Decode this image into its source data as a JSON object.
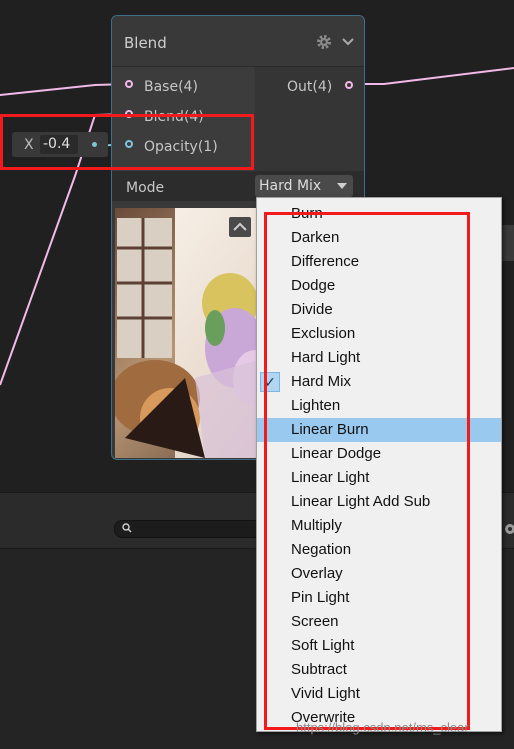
{
  "node": {
    "title": "Blend",
    "inputs": [
      {
        "label": "Base(4)"
      },
      {
        "label": "Blend(4)"
      },
      {
        "label": "Opacity(1)"
      }
    ],
    "output": {
      "label": "Out(4)"
    },
    "mode_label": "Mode",
    "mode_value": "Hard Mix"
  },
  "opacity_field": {
    "axis": "X",
    "value": "-0.4"
  },
  "dropdown": {
    "items": [
      "Burn",
      "Darken",
      "Difference",
      "Dodge",
      "Divide",
      "Exclusion",
      "Hard Light",
      "Hard Mix",
      "Lighten",
      "Linear Burn",
      "Linear Dodge",
      "Linear Light",
      "Linear Light Add Sub",
      "Multiply",
      "Negation",
      "Overlay",
      "Pin Light",
      "Screen",
      "Soft Light",
      "Subtract",
      "Vivid Light",
      "Overwrite"
    ],
    "selected": "Hard Mix",
    "highlighted": "Linear Burn",
    "check_mark": "✓"
  },
  "watermark": "https://blog.csdn.net/ms_clear",
  "colors": {
    "wire": "#f1b9e8",
    "node_border": "#3f6f87",
    "annotation": "#f21a1a",
    "highlight": "#99c9ef"
  }
}
